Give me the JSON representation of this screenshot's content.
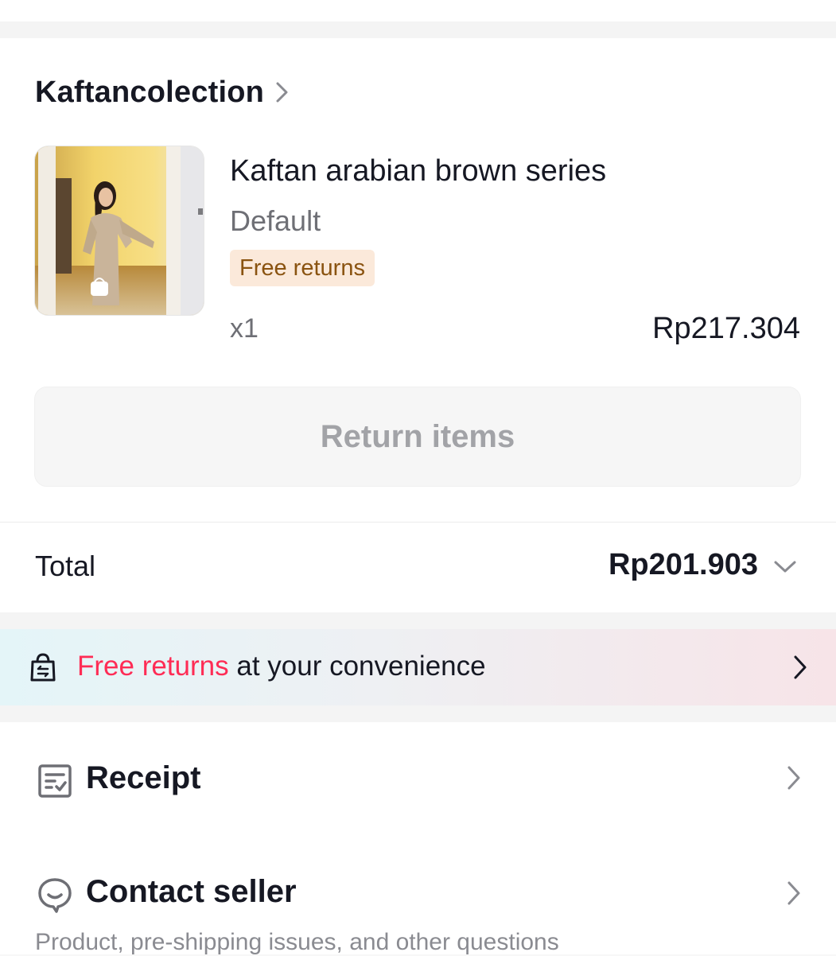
{
  "shop": {
    "name": "Kaftancolection"
  },
  "product": {
    "title": "Kaftan arabian brown series",
    "variant": "Default",
    "badge": "Free returns",
    "quantity": "x1",
    "price": "Rp217.304"
  },
  "actions": {
    "return_label": "Return items"
  },
  "total": {
    "label": "Total",
    "value": "Rp201.903"
  },
  "banner": {
    "highlight": "Free returns",
    "text": " at your convenience"
  },
  "menu": {
    "receipt_label": "Receipt",
    "contact_label": "Contact seller",
    "contact_sub": "Product, pre-shipping issues, and other questions"
  },
  "colors": {
    "accent": "#fe2c55",
    "badge_bg": "#fbe9da",
    "badge_text": "#8a5310",
    "text_primary": "#161823",
    "text_secondary": "#6e6f75"
  },
  "icons": {
    "shop_chevron": "chevron-right-icon",
    "total_chevron": "chevron-down-icon",
    "banner_icon": "return-bag-icon",
    "receipt_icon": "receipt-icon",
    "contact_icon": "chat-bubble-icon"
  }
}
